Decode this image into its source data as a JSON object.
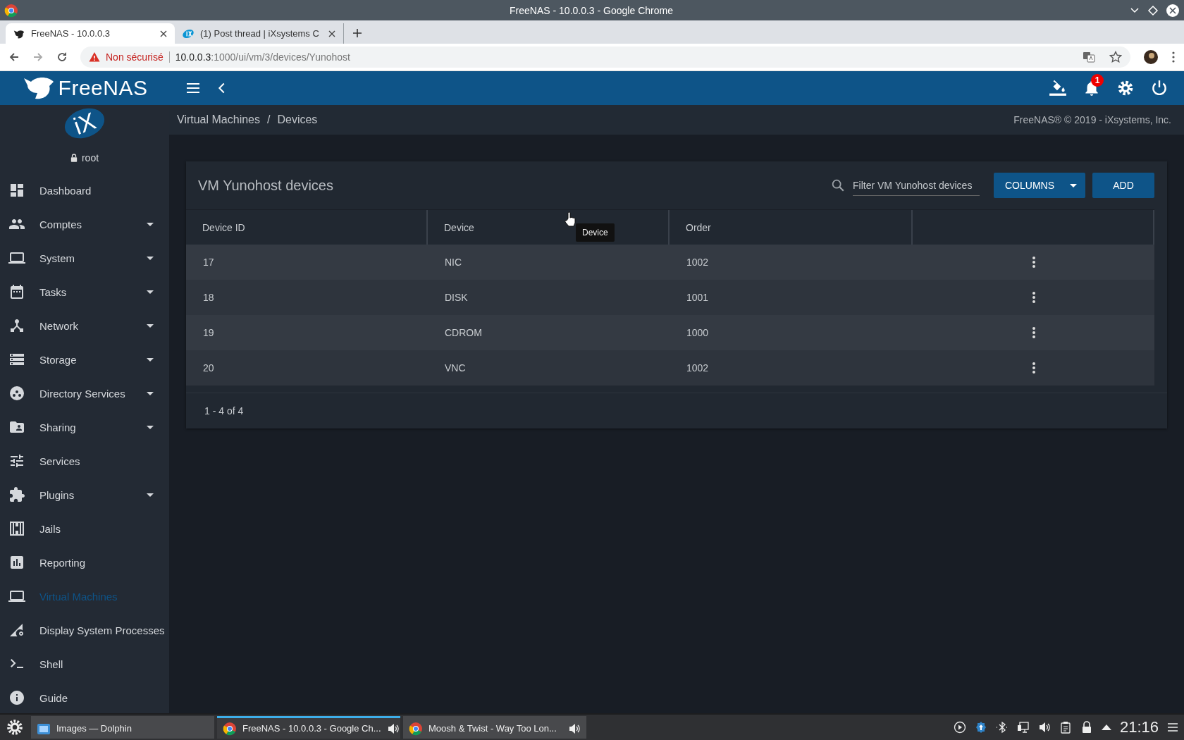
{
  "window": {
    "title": "FreeNAS - 10.0.0.3 - Google Chrome"
  },
  "browser_tabs": [
    {
      "title": "FreeNAS - 10.0.0.3",
      "selected": true,
      "kind": "freenas"
    },
    {
      "title": "(1) Post thread | iXsystems C",
      "selected": false,
      "kind": "ix"
    }
  ],
  "address_bar": {
    "security": "Non sécurisé",
    "host": "10.0.0.3",
    "path": ":1000/ui/vm/3/devices/Yunohost"
  },
  "topbar": {
    "logo": "FreeNAS",
    "notification_count": "1"
  },
  "sidebar": {
    "brand": "iX",
    "user": "root",
    "items": [
      {
        "label": "Dashboard",
        "kind": "dashboard",
        "expandable": false,
        "selected": false
      },
      {
        "label": "Comptes",
        "kind": "people",
        "expandable": true,
        "selected": false
      },
      {
        "label": "System",
        "kind": "laptop",
        "expandable": true,
        "selected": false
      },
      {
        "label": "Tasks",
        "kind": "calendar",
        "expandable": true,
        "selected": false
      },
      {
        "label": "Network",
        "kind": "hub",
        "expandable": true,
        "selected": false
      },
      {
        "label": "Storage",
        "kind": "storage",
        "expandable": true,
        "selected": false
      },
      {
        "label": "Directory Services",
        "kind": "bubbles",
        "expandable": true,
        "selected": false
      },
      {
        "label": "Sharing",
        "kind": "folder",
        "expandable": true,
        "selected": false
      },
      {
        "label": "Services",
        "kind": "tune",
        "expandable": false,
        "selected": false
      },
      {
        "label": "Plugins",
        "kind": "puzzle",
        "expandable": true,
        "selected": false
      },
      {
        "label": "Jails",
        "kind": "jail",
        "expandable": false,
        "selected": false
      },
      {
        "label": "Reporting",
        "kind": "chart",
        "expandable": false,
        "selected": false
      },
      {
        "label": "Virtual Machines",
        "kind": "laptop",
        "expandable": false,
        "selected": true
      },
      {
        "label": "Display System Processes",
        "kind": "process",
        "expandable": false,
        "selected": false
      },
      {
        "label": "Shell",
        "kind": "shell",
        "expandable": false,
        "selected": false
      },
      {
        "label": "Guide",
        "kind": "info",
        "expandable": false,
        "selected": false
      }
    ]
  },
  "breadcrumbs": [
    "Virtual Machines",
    "Devices"
  ],
  "breadcrumb_separator": "/",
  "copyright": "FreeNAS® © 2019 - iXsystems, Inc.",
  "card": {
    "title": "VM Yunohost devices",
    "filter": {
      "placeholder": "Filter VM Yunohost devices"
    },
    "columns_button": "COLUMNS",
    "add_button": "ADD",
    "columns": [
      "Device ID",
      "Device",
      "Order"
    ],
    "rows": [
      {
        "id": "17",
        "device": "NIC",
        "order": "1002"
      },
      {
        "id": "18",
        "device": "DISK",
        "order": "1001"
      },
      {
        "id": "19",
        "device": "CDROM",
        "order": "1000"
      },
      {
        "id": "20",
        "device": "VNC",
        "order": "1002"
      }
    ],
    "tooltip": "Device",
    "footer": "1 - 4 of 4"
  },
  "taskbar": {
    "tasks": [
      {
        "label": "Images — Dolphin",
        "kind": "dolphin",
        "selected": false,
        "audio": false
      },
      {
        "label": "FreeNAS - 10.0.0.3 - Google Ch...",
        "kind": "chrome",
        "selected": true,
        "audio": true
      },
      {
        "label": "Moosh & Twist - Way Too Lon...",
        "kind": "chrome",
        "selected": false,
        "audio": true
      }
    ],
    "clock": "21:16"
  }
}
